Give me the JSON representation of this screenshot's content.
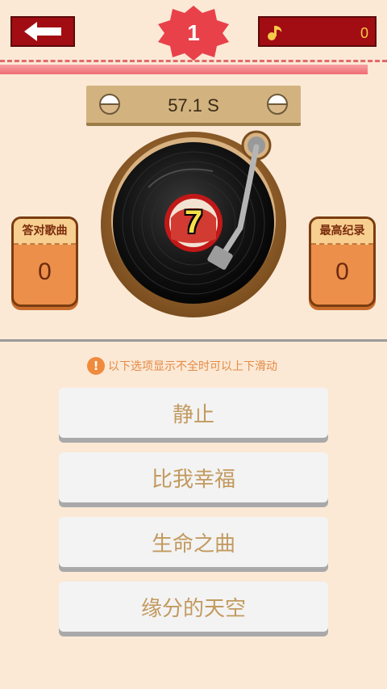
{
  "header": {
    "back_icon": "arrow-left-icon",
    "level": "1",
    "coin_icon": "music-note-icon",
    "coins": "0"
  },
  "progress": {
    "fraction": 0.95
  },
  "timer": {
    "text": "57.1 S"
  },
  "record": {
    "label": "7"
  },
  "left_panel": {
    "title": "答对歌曲",
    "value": "0"
  },
  "right_panel": {
    "title": "最高纪录",
    "value": "0"
  },
  "hint": {
    "icon": "!",
    "text": "以下选项显示不全时可以上下滑动"
  },
  "options": [
    {
      "label": "静止"
    },
    {
      "label": "比我幸福"
    },
    {
      "label": "生命之曲"
    },
    {
      "label": "缘分的天空"
    }
  ],
  "colors": {
    "accent_red": "#a10d12",
    "badge_red": "#e8414a",
    "panel_orange": "#ec8f4b"
  }
}
